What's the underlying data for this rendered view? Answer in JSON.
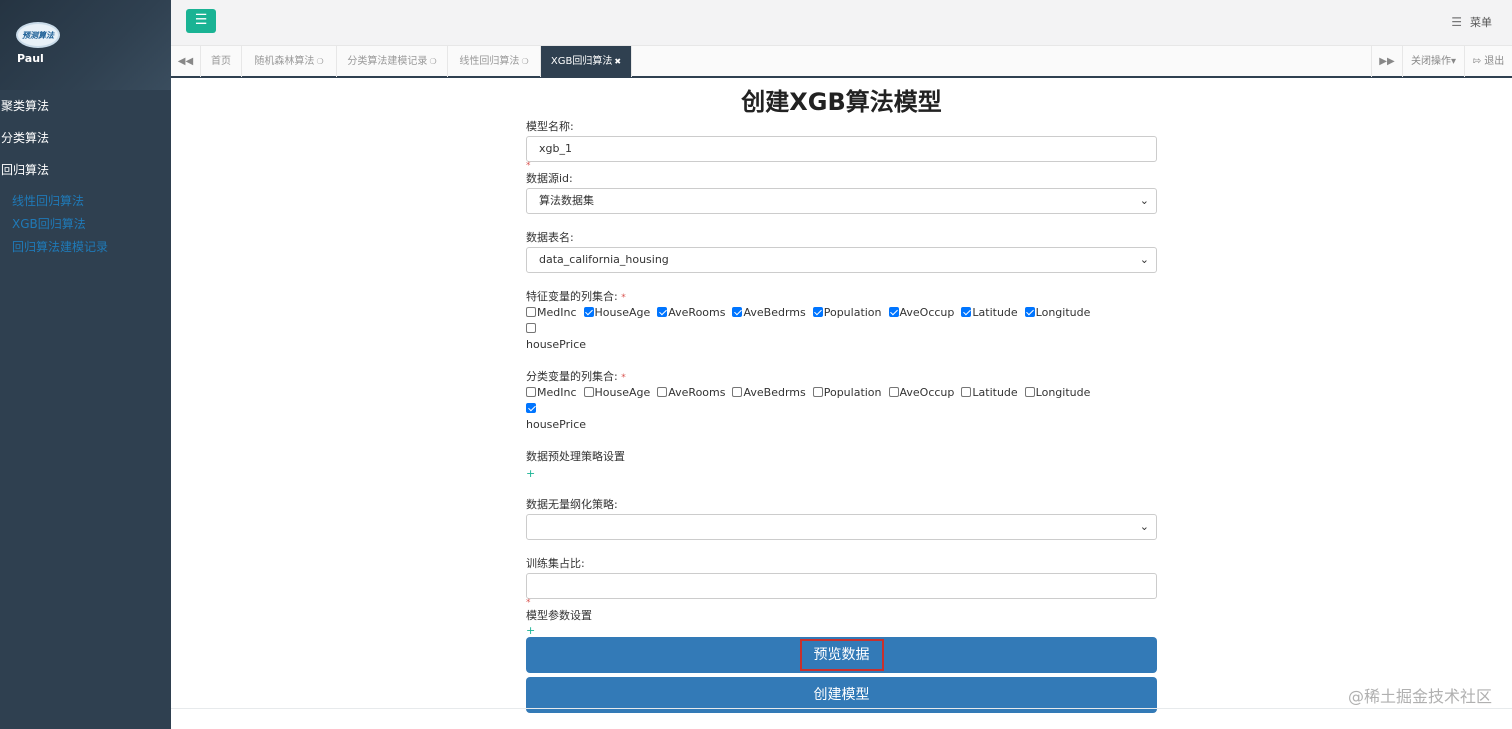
{
  "sidebar": {
    "logo_text": "预测算法",
    "username": "Paul",
    "groups": [
      "聚类算法",
      "分类算法",
      "回归算法"
    ],
    "sub_items": [
      "线性回归算法",
      "XGB回归算法",
      "回归算法建模记录"
    ]
  },
  "topbar": {
    "menu_label": "菜单",
    "hamburger_icon": "menu-icon"
  },
  "tabs": {
    "items": [
      {
        "label": "首页",
        "closable": false
      },
      {
        "label": "随机森林算法",
        "closable": true
      },
      {
        "label": "分类算法建模记录",
        "closable": true
      },
      {
        "label": "线性回归算法",
        "closable": true
      },
      {
        "label": "XGB回归算法",
        "closable": true,
        "active": true
      }
    ],
    "close_ops_label": "关闭操作▾",
    "logout_label": "退出"
  },
  "page": {
    "title": "创建XGB算法模型",
    "model_name_label": "模型名称:",
    "model_name_value": "xgb_1",
    "datasource_label": "数据源id:",
    "datasource_value": "算法数据集",
    "table_label": "数据表名:",
    "table_value": "data_california_housing",
    "feature_label": "特征变量的列集合:",
    "class_label": "分类变量的列集合:",
    "columns": [
      "MedInc",
      "HouseAge",
      "AveRooms",
      "AveBedrms",
      "Population",
      "AveOccup",
      "Latitude",
      "Longitude",
      "housePrice"
    ],
    "feature_checked": [
      false,
      true,
      true,
      true,
      true,
      true,
      true,
      true,
      false
    ],
    "class_checked": [
      false,
      false,
      false,
      false,
      false,
      false,
      false,
      false,
      true
    ],
    "preprocess_label": "数据预处理策略设置",
    "plus": "+",
    "dimensionless_label": "数据无量纲化策略:",
    "dimensionless_value": "",
    "train_ratio_label": "训练集占比:",
    "train_ratio_value": "",
    "model_params_label": "模型参数设置",
    "preview_button": "预览数据",
    "create_button": "创建模型",
    "required_mark": "*"
  },
  "watermark": "@稀土掘金技术社区",
  "colors": {
    "sidebar": "#2f4050",
    "accent": "#1ab394",
    "primary": "#337ab7",
    "highlight": "#c9302c"
  }
}
